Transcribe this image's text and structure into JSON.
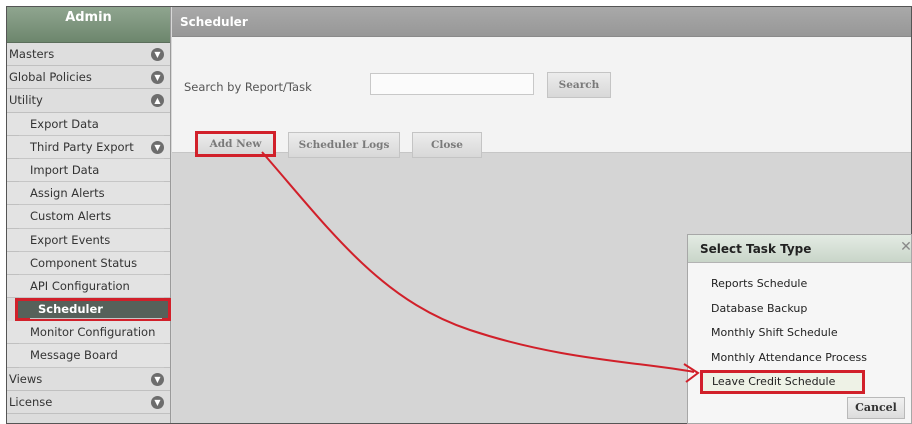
{
  "sidebar": {
    "title": "Admin",
    "items": [
      {
        "label": "Masters",
        "toggle": "down",
        "sub": false
      },
      {
        "label": "Global Policies",
        "toggle": "down",
        "sub": false
      },
      {
        "label": "Utility",
        "toggle": "up",
        "sub": false
      },
      {
        "label": "Export Data",
        "sub": true
      },
      {
        "label": "Third Party Export",
        "toggle": "down",
        "sub": true
      },
      {
        "label": "Import Data",
        "sub": true
      },
      {
        "label": "Assign Alerts",
        "sub": true
      },
      {
        "label": "Custom Alerts",
        "sub": true
      },
      {
        "label": "Export Events",
        "sub": true
      },
      {
        "label": "Component Status",
        "sub": true
      },
      {
        "label": "API Configuration",
        "sub": true
      },
      {
        "label": "Scheduler",
        "sub": true,
        "active": true
      },
      {
        "label": "Monitor Configuration",
        "sub": true
      },
      {
        "label": "Message Board",
        "sub": true
      },
      {
        "label": "Views",
        "toggle": "down",
        "sub": false
      },
      {
        "label": "License",
        "toggle": "down",
        "sub": false
      }
    ]
  },
  "main": {
    "title": "Scheduler",
    "search_label": "Search by Report/Task",
    "search_value": "",
    "search_button": "Search",
    "add_new": "Add New",
    "scheduler_logs": "Scheduler Logs",
    "close": "Close"
  },
  "dialog": {
    "title": "Select Task Type",
    "close_glyph": "✕",
    "options": [
      "Reports Schedule",
      "Database Backup",
      "Monthly Shift Schedule",
      "Monthly Attendance Process",
      "Leave Credit Schedule"
    ],
    "highlighted_option": "Leave Credit Schedule",
    "cancel": "Cancel"
  },
  "colors": {
    "highlight_red": "#d1202a",
    "sidebar_header": "#7a927a",
    "active_item": "#56615a"
  },
  "icons": {
    "expand": "chevron-down-icon",
    "collapse": "chevron-up-icon"
  }
}
